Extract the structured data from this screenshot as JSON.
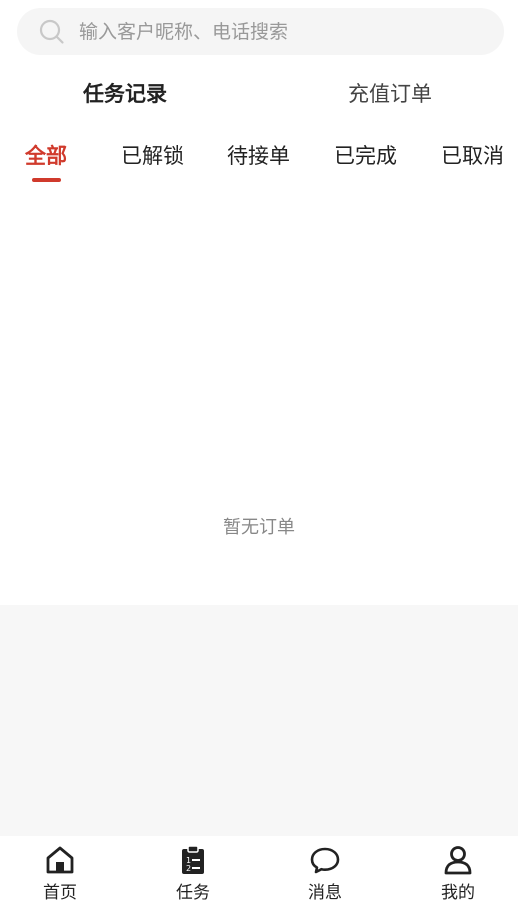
{
  "search": {
    "placeholder": "输入客户昵称、电话搜索",
    "value": ""
  },
  "main_tabs": [
    {
      "label": "任务记录",
      "active": true
    },
    {
      "label": "充值订单",
      "active": false
    }
  ],
  "sub_tabs": [
    {
      "label": "全部",
      "active": true
    },
    {
      "label": "已解锁",
      "active": false
    },
    {
      "label": "待接单",
      "active": false
    },
    {
      "label": "已完成",
      "active": false
    },
    {
      "label": "已取消",
      "active": false
    }
  ],
  "empty_message": "暂无订单",
  "bottom_nav": [
    {
      "label": "首页",
      "icon": "home-icon"
    },
    {
      "label": "任务",
      "icon": "clipboard-icon"
    },
    {
      "label": "消息",
      "icon": "chat-bubble-icon"
    },
    {
      "label": "我的",
      "icon": "user-icon"
    }
  ],
  "colors": {
    "accent": "#d03a2c",
    "text": "#222222",
    "placeholder": "#999999",
    "muted_bg": "#f7f7f7"
  }
}
